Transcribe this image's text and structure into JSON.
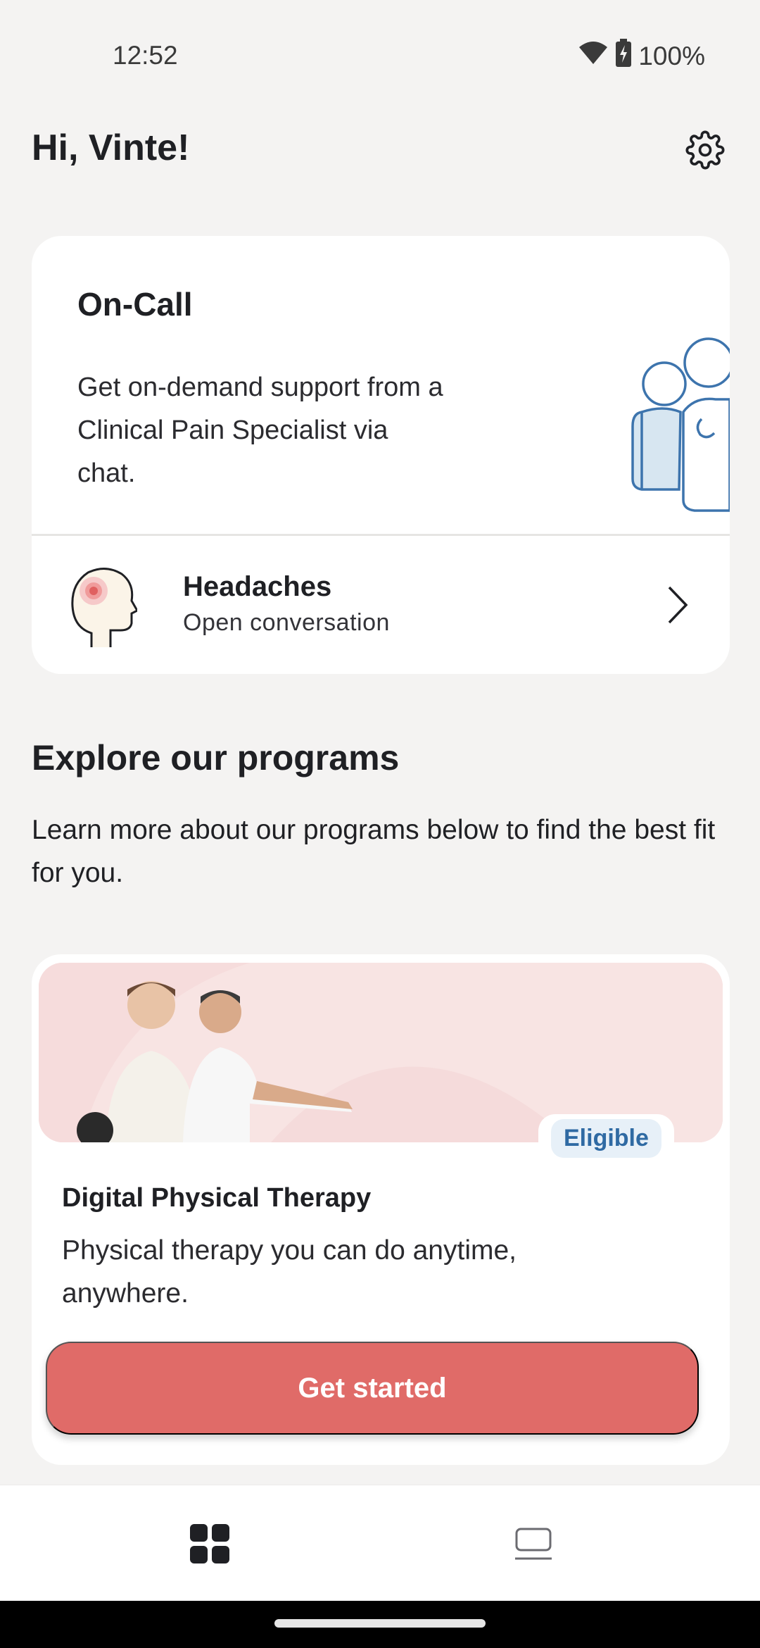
{
  "status_bar": {
    "time": "12:52",
    "battery": "100%",
    "icons": [
      "wifi-icon",
      "battery-charging-icon"
    ]
  },
  "header": {
    "greeting": "Hi, Vinte!",
    "settings_icon": "gear-icon"
  },
  "on_call": {
    "title": "On-Call",
    "description": "Get on-demand support from a Clinical Pain Specialist via chat.",
    "illustration": "specialists-illustration",
    "conversation": {
      "title": "Headaches",
      "subtitle": "Open conversation",
      "icon": "head-pain-icon",
      "chevron": "chevron-right-icon"
    }
  },
  "explore": {
    "title": "Explore our programs",
    "description": "Learn more about our programs below to find the best fit for you."
  },
  "program": {
    "badge": "Eligible",
    "title": "Digital Physical Therapy",
    "description": "Physical therapy you can do anytime, anywhere.",
    "cta": "Get started",
    "banner": "two-people-stretching-photo"
  },
  "bottom_nav": {
    "items": [
      {
        "icon": "grid-icon",
        "selected": true
      },
      {
        "icon": "device-icon",
        "selected": false
      }
    ]
  },
  "colors": {
    "background": "#f4f3f2",
    "cta": "#e06b68",
    "badge_text": "#2f6aa3",
    "banner": "#f6dcdc",
    "illustration_stroke": "#3d74ad"
  }
}
